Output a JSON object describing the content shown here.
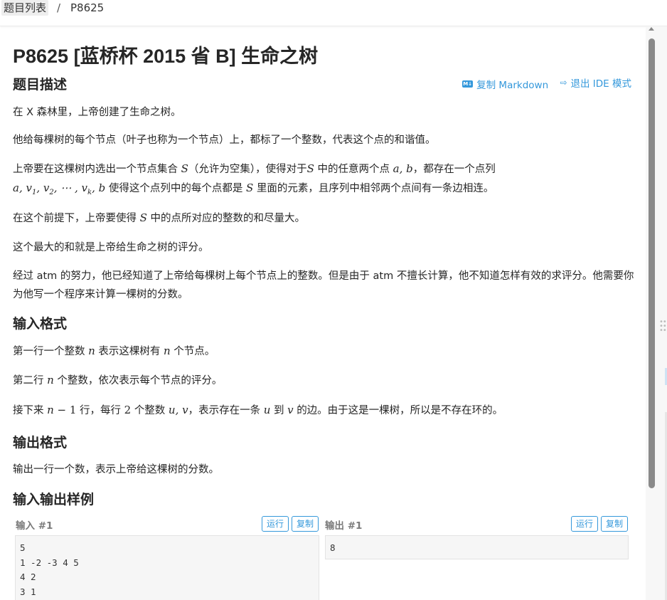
{
  "breadcrumb": {
    "list_label": "题目列表",
    "separator": "/",
    "current": "P8625"
  },
  "problem": {
    "title": "P8625 [蓝桥杯 2015 省 B] 生命之树"
  },
  "actions": {
    "copy_markdown": "复制 Markdown",
    "exit_ide": "退出 IDE 模式",
    "md_icon_text": "M↓"
  },
  "sections": {
    "description": "题目描述",
    "input_format": "输入格式",
    "output_format": "输出格式",
    "samples": "输入输出样例"
  },
  "description": {
    "p1": "在 X 森林里，上帝创建了生命之树。",
    "p2": "他给每棵树的每个节点（叶子也称为一个节点）上，都标了一个整数，代表这个点的和谐值。",
    "p3": {
      "a": "上帝要在这棵树内选出一个节点集合",
      "b": "（允许为空集），使得对于",
      "c": "中的任意两个点",
      "d": "，都存在一个点列",
      "e": "使得这个点列中的每个点都是",
      "f": "里面的元素，且序列中相邻两个点间有一条边相连。"
    },
    "p4": {
      "a": "在这个前提下，上帝要使得",
      "b": "中的点所对应的整数的和尽量大。"
    },
    "p5": "这个最大的和就是上帝给生命之树的评分。",
    "p6": "经过 atm 的努力，他已经知道了上帝给每棵树上每个节点上的整数。但是由于 atm 不擅长计算，他不知道怎样有效的求评分。他需要你为他写一个程序来计算一棵树的分数。"
  },
  "input_format": {
    "p1": {
      "a": "第一行一个整数",
      "b": "表示这棵树有",
      "c": "个节点。"
    },
    "p2": {
      "a": "第二行",
      "b": "个整数，依次表示每个节点的评分。"
    },
    "p3": {
      "a": "接下来",
      "b": "行，每行",
      "c": "个整数",
      "d": "，表示存在一条",
      "e": "到",
      "f": "的边。由于这是一棵树，所以是不存在环的。"
    }
  },
  "output_format": {
    "p1": "输出一行一个数，表示上帝给这棵树的分数。"
  },
  "samples": {
    "input_label": "输入 #1",
    "output_label": "输出 #1",
    "run_label": "运行",
    "copy_label": "复制",
    "input_text": "5\n1 -2 -3 4 5\n4 2\n3 1",
    "output_text": "8"
  }
}
